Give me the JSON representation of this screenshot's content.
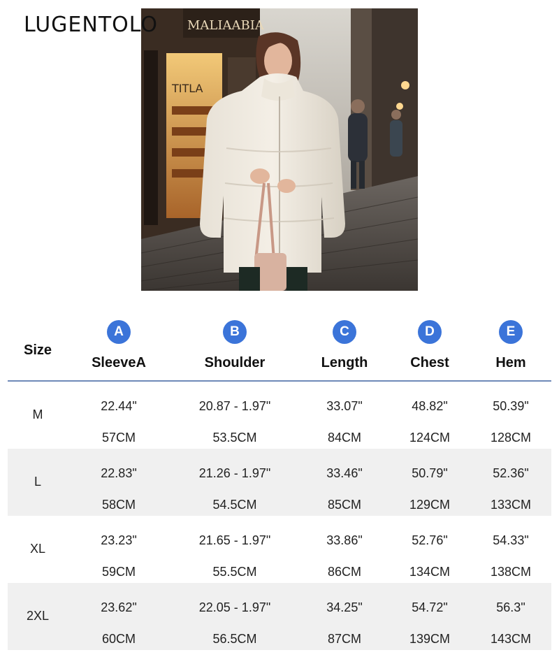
{
  "brand": {
    "text": "LUGENTOLO"
  },
  "photo": {
    "shop_sign": "MALIAABIA",
    "window_sign": "TITLA"
  },
  "table": {
    "size_header": "Size",
    "columns": [
      {
        "badge": "A",
        "label": "SleeveA"
      },
      {
        "badge": "B",
        "label": "Shoulder"
      },
      {
        "badge": "C",
        "label": "Length"
      },
      {
        "badge": "D",
        "label": "Chest"
      },
      {
        "badge": "E",
        "label": "Hem"
      }
    ],
    "rows": [
      {
        "size": "M",
        "inch": [
          "22.44\"",
          "20.87 - 1.97\"",
          "33.07\"",
          "48.82\"",
          "50.39\""
        ],
        "cm": [
          "57CM",
          "53.5CM",
          "84CM",
          "124CM",
          "128CM"
        ]
      },
      {
        "size": "L",
        "inch": [
          "22.83\"",
          "21.26 - 1.97\"",
          "33.46\"",
          "50.79\"",
          "52.36\""
        ],
        "cm": [
          "58CM",
          "54.5CM",
          "85CM",
          "129CM",
          "133CM"
        ]
      },
      {
        "size": "XL",
        "inch": [
          "23.23\"",
          "21.65 - 1.97\"",
          "33.86\"",
          "52.76\"",
          "54.33\""
        ],
        "cm": [
          "59CM",
          "55.5CM",
          "86CM",
          "134CM",
          "138CM"
        ]
      },
      {
        "size": "2XL",
        "inch": [
          "23.62\"",
          "22.05 - 1.97\"",
          "34.25\"",
          "54.72\"",
          "56.3\""
        ],
        "cm": [
          "60CM",
          "56.5CM",
          "87CM",
          "139CM",
          "143CM"
        ]
      }
    ]
  }
}
